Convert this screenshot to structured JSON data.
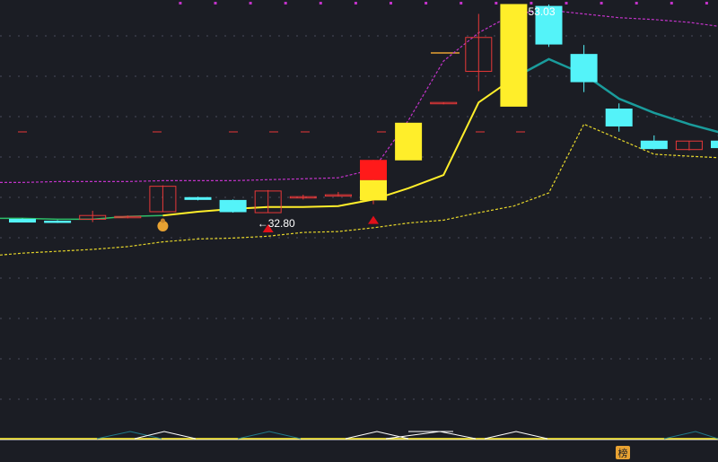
{
  "chart_data": {
    "type": "candlestick",
    "title": "",
    "price_range": [
      10,
      56
    ],
    "candles": [
      {
        "o": 33.2,
        "h": 33.3,
        "l": 32.9,
        "c": 32.9,
        "color": "cyan"
      },
      {
        "o": 33.0,
        "h": 33.1,
        "l": 32.8,
        "c": 32.9,
        "color": "cyan"
      },
      {
        "o": 33.2,
        "h": 34.1,
        "l": 32.9,
        "c": 33.6,
        "color": "red"
      },
      {
        "o": 33.5,
        "h": 33.6,
        "l": 33.3,
        "c": 33.5,
        "color": "red"
      },
      {
        "o": 34.0,
        "h": 36.8,
        "l": 34.0,
        "c": 36.7,
        "color": "red"
      },
      {
        "o": 35.5,
        "h": 35.6,
        "l": 35.2,
        "c": 35.3,
        "color": "cyan"
      },
      {
        "o": 35.2,
        "h": 35.3,
        "l": 33.9,
        "c": 34.0,
        "color": "cyan"
      },
      {
        "o": 33.9,
        "h": 36.3,
        "l": 33.9,
        "c": 36.2,
        "color": "red"
      },
      {
        "o": 35.5,
        "h": 35.8,
        "l": 35.3,
        "c": 35.6,
        "color": "red"
      },
      {
        "o": 35.8,
        "h": 36.1,
        "l": 35.6,
        "c": 35.8,
        "color": "red"
      },
      {
        "o": 35.2,
        "h": 39.5,
        "l": 34.8,
        "c": 39.5,
        "color": "red-yellow"
      },
      {
        "o": 39.5,
        "h": 43.4,
        "l": 39.5,
        "c": 43.4,
        "color": "yellow"
      },
      {
        "o": 45.5,
        "h": 45.6,
        "l": 45.4,
        "c": 45.6,
        "color": "red"
      },
      {
        "o": 48.9,
        "h": 55.0,
        "l": 46.8,
        "c": 52.5,
        "color": "red"
      },
      {
        "o": 45.2,
        "h": 56.0,
        "l": 45.2,
        "c": 56.0,
        "color": "yellow"
      },
      {
        "o": 55.8,
        "h": 56.0,
        "l": 51.5,
        "c": 51.8,
        "color": "cyan"
      },
      {
        "o": 50.7,
        "h": 51.7,
        "l": 46.7,
        "c": 47.8,
        "color": "cyan"
      },
      {
        "o": 44.9,
        "h": 45.5,
        "l": 42.5,
        "c": 43.1,
        "color": "cyan"
      },
      {
        "o": 41.5,
        "h": 42.1,
        "l": 40.6,
        "c": 40.7,
        "color": "cyan"
      },
      {
        "o": 40.6,
        "h": 41.5,
        "l": 40.5,
        "c": 41.5,
        "color": "red"
      },
      {
        "o": 41.5,
        "h": 41.6,
        "l": 40.8,
        "c": 40.8,
        "color": "cyan"
      }
    ],
    "ma_line": [
      33.3,
      33.2,
      33.2,
      33.5,
      33.6,
      34.0,
      34.3,
      34.5,
      34.5,
      34.6,
      35.3,
      36.5,
      37.9,
      45.6,
      48.2,
      50.2,
      48.6,
      46.0,
      44.5,
      43.3,
      42.3
    ],
    "upper_band": [
      37.1,
      37.2,
      37.2,
      37.2,
      37.3,
      37.3,
      37.3,
      37.4,
      37.5,
      37.6,
      38.5,
      43.7,
      50.0,
      53.0,
      55.0,
      55.4,
      55.0,
      54.6,
      54.4,
      54.1,
      53.6
    ],
    "lower_band": [
      29.6,
      29.8,
      30.0,
      30.3,
      30.8,
      31.1,
      31.2,
      31.4,
      31.8,
      31.9,
      32.3,
      32.8,
      33.1,
      33.9,
      34.6,
      36.0,
      43.3,
      41.7,
      40.1,
      39.9,
      39.7
    ],
    "annotations": [
      {
        "text": "←32.80",
        "candle": 7,
        "value": 32.8
      },
      {
        "text": "53.03",
        "candle": 15,
        "value": 56.0
      }
    ],
    "buy_signals": [
      7,
      10
    ],
    "money_icon_candle": 4,
    "indicator_badge": "榜",
    "grid": true,
    "colors": {
      "background": "#1b1d24",
      "up": "#e83838",
      "down": "#54f3f9",
      "yellow": "#ffee2a",
      "ma": "#ffee2a",
      "upper_band": "#c233c9",
      "lower_band": "#e6d62a",
      "grid": "#5b6176",
      "signal": "#e0101a"
    }
  }
}
